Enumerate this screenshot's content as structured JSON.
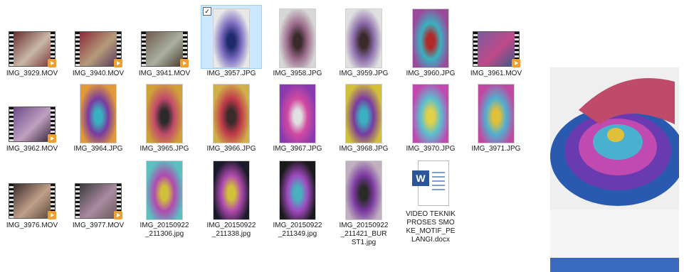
{
  "files": [
    {
      "name": "IMG_3929.MOV",
      "type": "video",
      "colors": [
        "#6a2c2c",
        "#c9b8a8",
        "#7a3a3a"
      ]
    },
    {
      "name": "IMG_3940.MOV",
      "type": "video",
      "colors": [
        "#8a2a3a",
        "#b59a7a",
        "#5a3a5a"
      ]
    },
    {
      "name": "IMG_3941.MOV",
      "type": "video",
      "colors": [
        "#6e5a4a",
        "#aab0a0",
        "#4a3a2a"
      ]
    },
    {
      "name": "IMG_3957.JPG",
      "type": "photo",
      "selected": true,
      "colors": [
        "#e8e8e8",
        "#7a6abf",
        "#1f2a6a"
      ]
    },
    {
      "name": "IMG_3958.JPG",
      "type": "photo",
      "colors": [
        "#d7d7d7",
        "#9a6a8a",
        "#3a2a2a"
      ]
    },
    {
      "name": "IMG_3959.JPG",
      "type": "photo",
      "colors": [
        "#e0e0e0",
        "#8a6aa8",
        "#3a2a2a"
      ]
    },
    {
      "name": "IMG_3960.JPG",
      "type": "photo",
      "colors": [
        "#9a4a9a",
        "#3ab0c0",
        "#b02a2a"
      ]
    },
    {
      "name": "IMG_3961.MOV",
      "type": "video",
      "colors": [
        "#7a5aa0",
        "#c04a8a",
        "#3a5a8a"
      ]
    },
    {
      "name": "IMG_3962.MOV",
      "type": "video",
      "colors": [
        "#6a4a8a",
        "#c0a0c0",
        "#3a2a3a"
      ]
    },
    {
      "name": "IMG_3964.JPG",
      "type": "photo",
      "colors": [
        "#e09a3a",
        "#7a3aa0",
        "#3ab0c0"
      ]
    },
    {
      "name": "IMG_3965.JPG",
      "type": "photo",
      "colors": [
        "#d0a03a",
        "#c04a6a",
        "#2a2a2a"
      ]
    },
    {
      "name": "IMG_3966.JPG",
      "type": "photo",
      "colors": [
        "#d0b04a",
        "#c03a4a",
        "#3a2a2a"
      ]
    },
    {
      "name": "IMG_3967.JPG",
      "type": "photo",
      "colors": [
        "#8a3ab0",
        "#d04aa0",
        "#e0e0e0"
      ]
    },
    {
      "name": "IMG_3968.JPG",
      "type": "photo",
      "colors": [
        "#d0c03a",
        "#7a3aa0",
        "#3ab0c0"
      ]
    },
    {
      "name": "IMG_3970.JPG",
      "type": "photo",
      "colors": [
        "#c04ab0",
        "#5ac0d0",
        "#e0d04a"
      ]
    },
    {
      "name": "IMG_3971.JPG",
      "type": "photo",
      "colors": [
        "#c04aa0",
        "#50b0d0",
        "#e0c03a"
      ]
    },
    {
      "name": "IMG_3976.MOV",
      "type": "video",
      "colors": [
        "#3a2a2a",
        "#c0a08a",
        "#5a4a3a"
      ]
    },
    {
      "name": "IMG_3977.MOV",
      "type": "video",
      "colors": [
        "#3a3a3a",
        "#aa8aa0",
        "#6a5a5a"
      ]
    },
    {
      "name": "IMG_20150922_211306.jpg",
      "type": "photo",
      "colors": [
        "#5ac0c0",
        "#b04ab0",
        "#d0c03a"
      ]
    },
    {
      "name": "IMG_20150922_211338.jpg",
      "type": "photo",
      "colors": [
        "#1a1a2a",
        "#b04ab0",
        "#d0c03a"
      ]
    },
    {
      "name": "IMG_20150922_211349.jpg",
      "type": "photo",
      "colors": [
        "#1a1a1a",
        "#a04ac0",
        "#4ab0c0"
      ]
    },
    {
      "name": "IMG_20150922_211421_BURST1.jpg",
      "type": "photo",
      "colors": [
        "#c0b0c0",
        "#7a3aa0",
        "#2a2a2a"
      ]
    },
    {
      "name": "VIDEO TEKNIK PROSES SMOKE_MOTIF_PELANGI.docx",
      "type": "doc"
    }
  ],
  "preview": {
    "colors": [
      "#f2f2f2",
      "#6a3ab0",
      "#c04ab0",
      "#4ab0d0",
      "#1a3a8a",
      "#d06a6a",
      "#2a5ab0"
    ]
  },
  "accent_selected": "#cce8ff",
  "word_icon_color": "#2b579a",
  "word_icon_letter": "W"
}
